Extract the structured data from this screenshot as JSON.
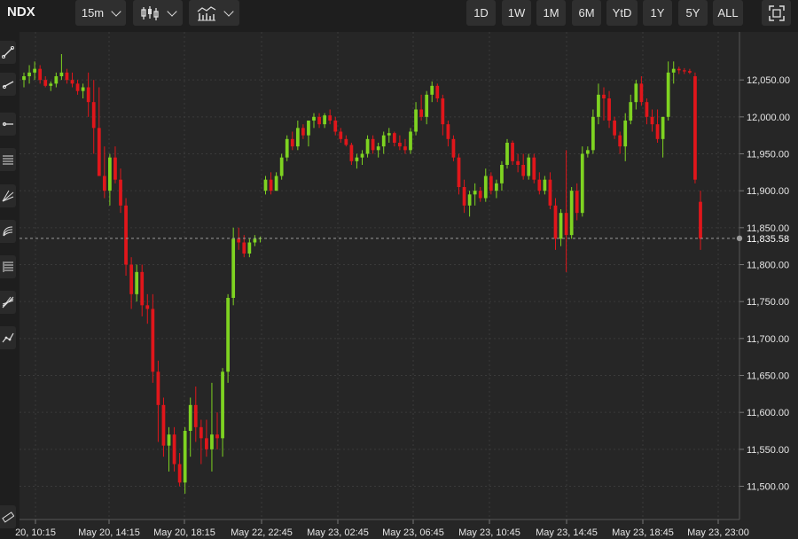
{
  "symbol": "NDX",
  "interval": "15m",
  "chart_type_icon": "candlestick-icon",
  "indicators_icon": "indicators-icon",
  "ranges": [
    "1D",
    "1W",
    "1M",
    "6M",
    "YtD",
    "1Y",
    "5Y",
    "ALL"
  ],
  "fullscreen_icon": "fullscreen-icon",
  "sidebar_tools": [
    "trendline-icon",
    "ray-icon",
    "horizontal-ray-icon",
    "channel-icon",
    "pitchfork-icon",
    "fib-arc-icon",
    "fib-retracement-icon",
    "fib-fan-icon",
    "path-icon"
  ],
  "sidebar_bottom_tool": "ruler-icon",
  "colors": {
    "up": "#7ed321",
    "down": "#e0161b",
    "background": "#262626",
    "grid": "#3a3a3a"
  },
  "chart_data": {
    "type": "candlestick",
    "x_ticks": [
      "20, 10:15",
      "May 20, 14:15",
      "May 20, 18:15",
      "May 22, 22:45",
      "May 23, 02:45",
      "May 23, 06:45",
      "May 23, 10:45",
      "May 23, 14:45",
      "May 23, 18:45",
      "May 23, 23:00"
    ],
    "y_ticks": [
      12050,
      12000,
      11950,
      11900,
      11850,
      11800,
      11750,
      11700,
      11650,
      11600,
      11550,
      11500
    ],
    "y_tick_labels": [
      "12,050.00",
      "12,000.00",
      "11,950.00",
      "11,900.00",
      "11,850.00",
      "11,800.00",
      "11,750.00",
      "11,700.00",
      "11,650.00",
      "11,600.00",
      "11,550.00",
      "11,500.00"
    ],
    "ylim": [
      11455,
      12115
    ],
    "grid": true,
    "last_price": 11835.58,
    "last_price_label": "11,835.58",
    "candles": [
      [
        12050,
        12060,
        12040,
        12055
      ],
      [
        12055,
        12070,
        12045,
        12060
      ],
      [
        12060,
        12075,
        12050,
        12065
      ],
      [
        12065,
        12070,
        12045,
        12050
      ],
      [
        12050,
        12055,
        12040,
        12042
      ],
      [
        12042,
        12048,
        12035,
        12045
      ],
      [
        12045,
        12060,
        12040,
        12055
      ],
      [
        12055,
        12085,
        12050,
        12060
      ],
      [
        12060,
        12065,
        12045,
        12050
      ],
      [
        12050,
        12060,
        12040,
        12045
      ],
      [
        12045,
        12050,
        12030,
        12035
      ],
      [
        12035,
        12045,
        12025,
        12040
      ],
      [
        12040,
        12060,
        12000,
        12020
      ],
      [
        12020,
        12050,
        11950,
        11985
      ],
      [
        11985,
        12040,
        11930,
        11920
      ],
      [
        11920,
        11960,
        11890,
        11900
      ],
      [
        11900,
        11950,
        11880,
        11945
      ],
      [
        11945,
        11960,
        11910,
        11915
      ],
      [
        11915,
        11930,
        11870,
        11880
      ],
      [
        11880,
        11890,
        11785,
        11800
      ],
      [
        11800,
        11810,
        11740,
        11760
      ],
      [
        11760,
        11800,
        11750,
        11790
      ],
      [
        11790,
        11800,
        11730,
        11745
      ],
      [
        11745,
        11760,
        11720,
        11740
      ],
      [
        11740,
        11760,
        11640,
        11655
      ],
      [
        11655,
        11670,
        11560,
        11610
      ],
      [
        11610,
        11620,
        11540,
        11555
      ],
      [
        11555,
        11580,
        11520,
        11570
      ],
      [
        11570,
        11580,
        11520,
        11530
      ],
      [
        11530,
        11545,
        11500,
        11505
      ],
      [
        11505,
        11580,
        11490,
        11575
      ],
      [
        11575,
        11620,
        11540,
        11610
      ],
      [
        11610,
        11635,
        11560,
        11580
      ],
      [
        11580,
        11590,
        11530,
        11565
      ],
      [
        11565,
        11590,
        11540,
        11550
      ],
      [
        11550,
        11640,
        11520,
        11570
      ],
      [
        11570,
        11600,
        11550,
        11565
      ],
      [
        11565,
        11660,
        11540,
        11655
      ],
      [
        11655,
        11760,
        11640,
        11755
      ],
      [
        11755,
        11850,
        11745,
        11835
      ],
      [
        11835,
        11850,
        11820,
        11830
      ],
      [
        11830,
        11840,
        11810,
        11815
      ],
      [
        11815,
        11835,
        11810,
        11830
      ],
      [
        11830,
        11840,
        11825,
        11835
      ],
      [
        11835,
        11838,
        11830,
        11836
      ],
      [
        11900,
        11920,
        11895,
        11915
      ],
      [
        11915,
        11925,
        11895,
        11900
      ],
      [
        11900,
        11925,
        11900,
        11920
      ],
      [
        11920,
        11950,
        11915,
        11945
      ],
      [
        11945,
        11975,
        11940,
        11970
      ],
      [
        11970,
        11980,
        11955,
        11960
      ],
      [
        11960,
        11995,
        11955,
        11985
      ],
      [
        11985,
        11990,
        11970,
        11975
      ],
      [
        11975,
        11990,
        11960,
        11995
      ],
      [
        11995,
        12005,
        11985,
        12000
      ],
      [
        12000,
        12005,
        11985,
        11990
      ],
      [
        11990,
        12005,
        11985,
        12002
      ],
      [
        12002,
        12010,
        11990,
        11995
      ],
      [
        11995,
        12000,
        11975,
        11980
      ],
      [
        11980,
        11985,
        11965,
        11970
      ],
      [
        11970,
        11975,
        11960,
        11962
      ],
      [
        11962,
        11965,
        11935,
        11940
      ],
      [
        11940,
        11950,
        11930,
        11945
      ],
      [
        11945,
        11955,
        11935,
        11950
      ],
      [
        11950,
        11975,
        11945,
        11970
      ],
      [
        11970,
        11975,
        11950,
        11955
      ],
      [
        11955,
        11965,
        11945,
        11960
      ],
      [
        11960,
        11980,
        11950,
        11975
      ],
      [
        11975,
        11985,
        11965,
        11978
      ],
      [
        11978,
        11980,
        11960,
        11965
      ],
      [
        11965,
        11975,
        11955,
        11960
      ],
      [
        11960,
        11970,
        11950,
        11955
      ],
      [
        11955,
        11985,
        11950,
        11980
      ],
      [
        11980,
        12020,
        11975,
        12010
      ],
      [
        12010,
        12030,
        11995,
        12000
      ],
      [
        12000,
        12035,
        11990,
        12030
      ],
      [
        12030,
        12048,
        12020,
        12042
      ],
      [
        12042,
        12045,
        12020,
        12025
      ],
      [
        12025,
        12030,
        11975,
        11990
      ],
      [
        11990,
        11995,
        11960,
        11970
      ],
      [
        11970,
        11975,
        11940,
        11945
      ],
      [
        11945,
        11950,
        11895,
        11905
      ],
      [
        11905,
        11915,
        11870,
        11880
      ],
      [
        11880,
        11900,
        11865,
        11895
      ],
      [
        11895,
        11910,
        11880,
        11900
      ],
      [
        11900,
        11905,
        11885,
        11890
      ],
      [
        11890,
        11930,
        11885,
        11920
      ],
      [
        11920,
        11925,
        11895,
        11900
      ],
      [
        11900,
        11915,
        11890,
        11910
      ],
      [
        11910,
        11940,
        11900,
        11935
      ],
      [
        11935,
        11970,
        11930,
        11965
      ],
      [
        11965,
        11968,
        11935,
        11940
      ],
      [
        11940,
        11950,
        11925,
        11935
      ],
      [
        11935,
        11950,
        11915,
        11920
      ],
      [
        11920,
        11950,
        11915,
        11945
      ],
      [
        11945,
        11950,
        11910,
        11915
      ],
      [
        11915,
        11925,
        11895,
        11900
      ],
      [
        11900,
        11920,
        11895,
        11915
      ],
      [
        11915,
        11925,
        11875,
        11880
      ],
      [
        11880,
        11890,
        11820,
        11835
      ],
      [
        11835,
        11875,
        11825,
        11870
      ],
      [
        11870,
        11955,
        11790,
        11840
      ],
      [
        11840,
        11905,
        11835,
        11900
      ],
      [
        11900,
        11910,
        11860,
        11870
      ],
      [
        11870,
        11960,
        11865,
        11950
      ],
      [
        11950,
        11960,
        11945,
        11955
      ],
      [
        11955,
        12010,
        11950,
        12000
      ],
      [
        12000,
        12045,
        11990,
        12030
      ],
      [
        12030,
        12040,
        11995,
        12025
      ],
      [
        12025,
        12035,
        11985,
        11995
      ],
      [
        11995,
        12000,
        11970,
        11975
      ],
      [
        11975,
        11980,
        11950,
        11960
      ],
      [
        11960,
        12005,
        11940,
        11995
      ],
      [
        11995,
        12030,
        11990,
        12020
      ],
      [
        12020,
        12050,
        12010,
        12045
      ],
      [
        12045,
        12055,
        12015,
        12020
      ],
      [
        12020,
        12025,
        11990,
        12000
      ],
      [
        12000,
        12010,
        11980,
        11990
      ],
      [
        11990,
        12010,
        11965,
        11970
      ],
      [
        11970,
        11995,
        11945,
        12000
      ],
      [
        12000,
        12075,
        11995,
        12060
      ],
      [
        12060,
        12075,
        12045,
        12065
      ],
      [
        12065,
        12068,
        12058,
        12063
      ],
      [
        12063,
        12066,
        12058,
        12062
      ],
      [
        12062,
        12065,
        12058,
        12060
      ],
      [
        12055,
        12060,
        11910,
        11915
      ],
      [
        11885,
        11900,
        11820,
        11835
      ]
    ]
  }
}
